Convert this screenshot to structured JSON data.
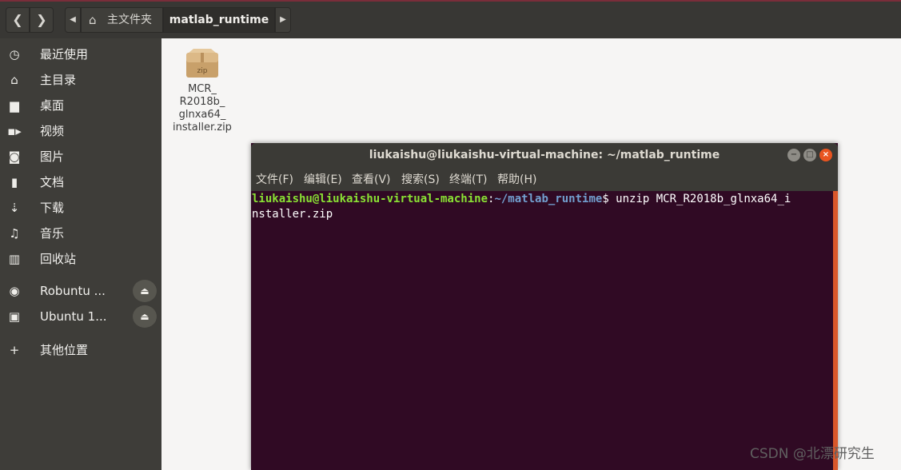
{
  "header": {
    "back_icon": "chevron-left-icon",
    "forward_icon": "chevron-right-icon",
    "breadcrumb_left_icon": "triangle-left-icon",
    "breadcrumb_right_icon": "triangle-right-icon",
    "home_icon": "home-icon",
    "home_label": "主文件夹",
    "current_folder": "matlab_runtime"
  },
  "sidebar": {
    "items": [
      {
        "icon": "clock-icon",
        "label": "最近使用"
      },
      {
        "icon": "home-icon",
        "label": "主目录"
      },
      {
        "icon": "folder-icon",
        "label": "桌面"
      },
      {
        "icon": "video-icon",
        "label": "视频"
      },
      {
        "icon": "camera-icon",
        "label": "图片"
      },
      {
        "icon": "document-icon",
        "label": "文档"
      },
      {
        "icon": "download-icon",
        "label": "下载"
      },
      {
        "icon": "music-icon",
        "label": "音乐"
      },
      {
        "icon": "trash-icon",
        "label": "回收站"
      },
      {
        "icon": "disc-icon",
        "label": "Robuntu ..."
      },
      {
        "icon": "drive-icon",
        "label": "Ubuntu 1..."
      },
      {
        "icon": "plus-icon",
        "label": "其他位置"
      }
    ],
    "eject_icon": "eject-icon"
  },
  "files": [
    {
      "icon": "zip-archive-icon",
      "icon_text": "zip",
      "name": "MCR_\nR2018b_\nglnxa64_\ninstaller.zip"
    }
  ],
  "terminal": {
    "title": "liukaishu@liukaishu-virtual-machine: ~/matlab_runtime",
    "menu": [
      "文件(F)",
      "编辑(E)",
      "查看(V)",
      "搜索(S)",
      "终端(T)",
      "帮助(H)"
    ],
    "prompt_user": "liukaishu@liukaishu-virtual-machine",
    "prompt_sep": ":",
    "prompt_path": "~/matlab_runtime",
    "prompt_symbol": "$ ",
    "command_line1": "unzip MCR_R2018b_glnxa64_i",
    "command_line2": "nstaller.zip",
    "colors": {
      "user": "#8ae234",
      "path": "#729fcf",
      "background": "#300a24"
    }
  },
  "watermark": "CSDN @北漂研究生"
}
